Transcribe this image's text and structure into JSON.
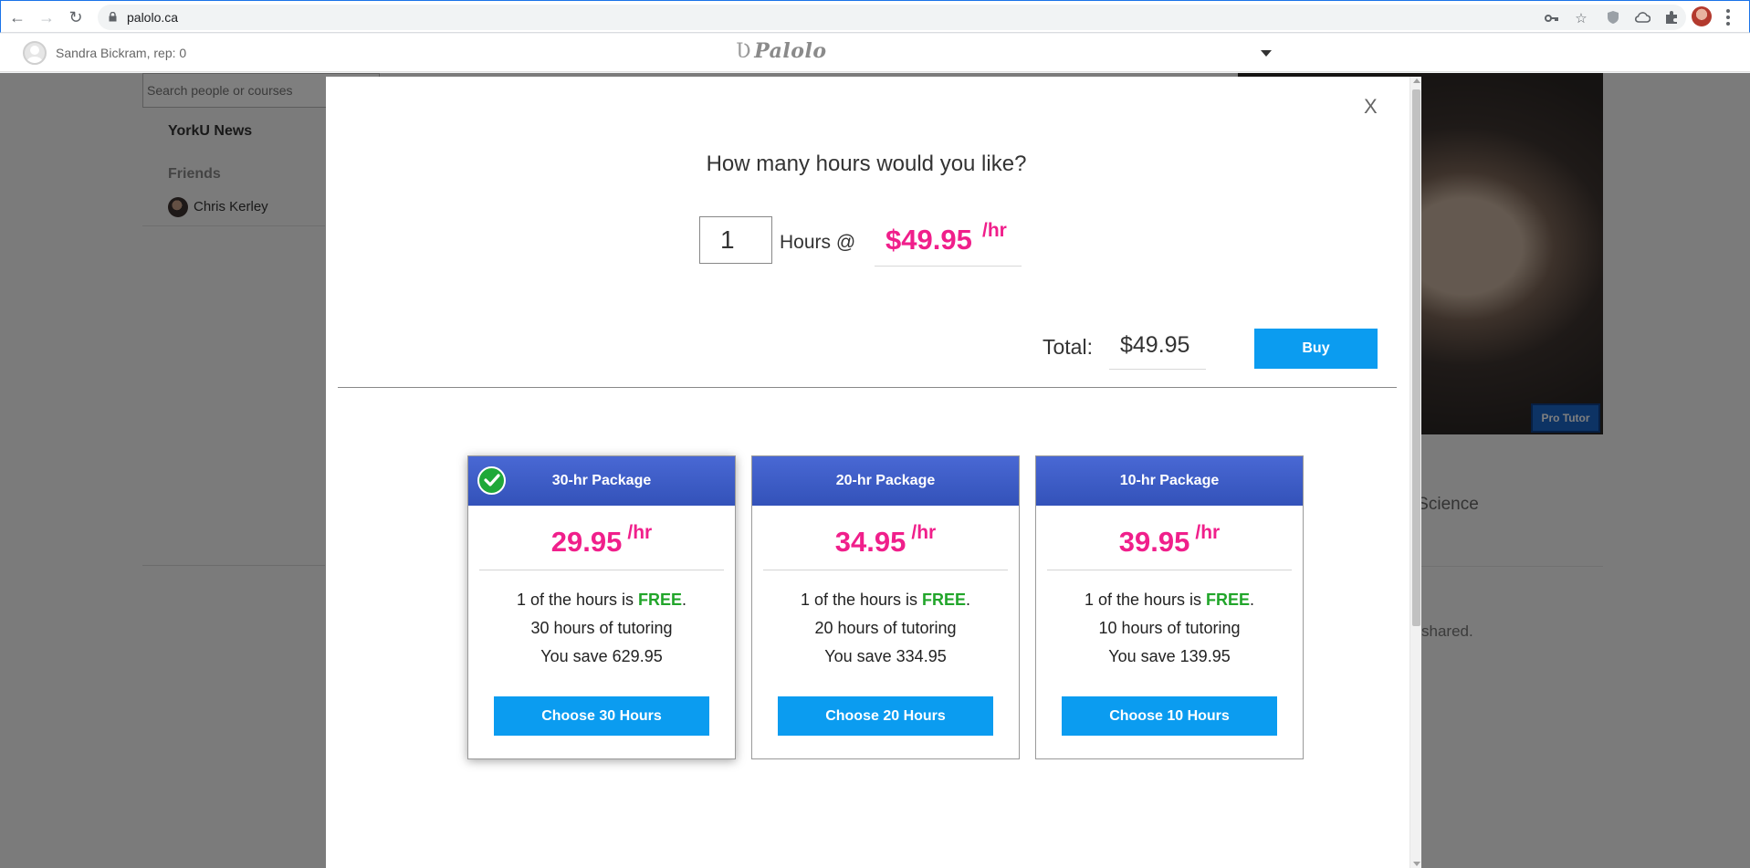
{
  "browser": {
    "url": "palolo.ca"
  },
  "header": {
    "user": "Sandra Bickram, rep: 0",
    "logo_text": "Palolo",
    "logo_mark": "Ʋ"
  },
  "sidebar": {
    "search_placeholder": "Search people or courses",
    "news_label": "YorkU News",
    "friends_label": "Friends",
    "friends": [
      {
        "name": "Chris Kerley"
      }
    ]
  },
  "background": {
    "pro_tutor_label": "Pro Tutor",
    "course_fragment": "er Science",
    "shared_fragment": "shared."
  },
  "modal": {
    "close_label": "X",
    "question": "How many hours would you like?",
    "hours_value": "1",
    "hours_at_label": "Hours @",
    "rate_price": "$49.95",
    "rate_unit": "/hr",
    "total_label": "Total:",
    "total_value": "$49.95",
    "buy_label": "Buy",
    "packages": [
      {
        "title": "30-hr Package",
        "selected": true,
        "price": "29.95",
        "unit": "/hr",
        "free_prefix": "1 of the hours is ",
        "free_word": "FREE",
        "free_suffix": ".",
        "hours_line": "30 hours of tutoring",
        "save_line": "You save 629.95",
        "button": "Choose 30 Hours"
      },
      {
        "title": "20-hr Package",
        "selected": false,
        "price": "34.95",
        "unit": "/hr",
        "free_prefix": "1 of the hours is ",
        "free_word": "FREE",
        "free_suffix": ".",
        "hours_line": "20 hours of tutoring",
        "save_line": "You save 334.95",
        "button": "Choose 20 Hours"
      },
      {
        "title": "10-hr Package",
        "selected": false,
        "price": "39.95",
        "unit": "/hr",
        "free_prefix": "1 of the hours is ",
        "free_word": "FREE",
        "free_suffix": ".",
        "hours_line": "10 hours of tutoring",
        "save_line": "You save 139.95",
        "button": "Choose 10 Hours"
      }
    ]
  },
  "colors": {
    "accent_pink": "#f01f8b",
    "button_blue": "#0b9cf0",
    "header_blue": "#3f5ec7",
    "free_green": "#21a52a"
  },
  "icons": [
    "back-icon",
    "forward-icon",
    "reload-icon",
    "lock-icon",
    "key-icon",
    "star-icon",
    "shield-icon",
    "cloud-icon",
    "puzzle-icon",
    "check-icon",
    "caret-down-icon"
  ]
}
